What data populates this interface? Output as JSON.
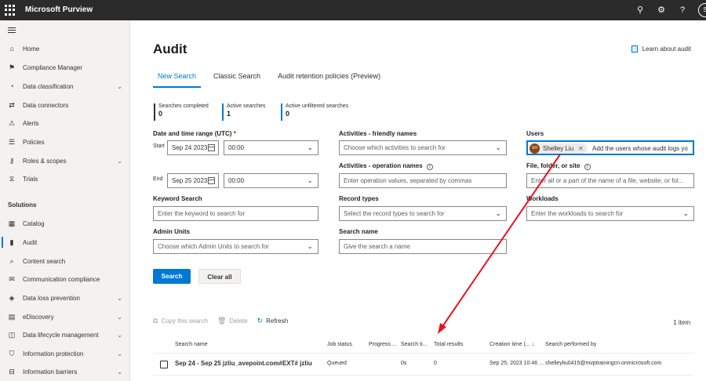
{
  "app": {
    "title": "Microsoft Purview",
    "avatar_initial": "S"
  },
  "topbar_icons": [
    {
      "name": "share-icon",
      "glyph": "⚲"
    },
    {
      "name": "gear-icon",
      "glyph": "⚙"
    },
    {
      "name": "help-icon",
      "glyph": "?"
    }
  ],
  "sidebar": {
    "items": [
      {
        "label": "Home",
        "icon": "⌂"
      },
      {
        "label": "Compliance Manager",
        "icon": "⚑"
      },
      {
        "label": "Data classification",
        "icon": "◔",
        "chevron": true
      },
      {
        "label": "Data connectors",
        "icon": "⇄"
      },
      {
        "label": "Alerts",
        "icon": "⚠"
      },
      {
        "label": "Policies",
        "icon": "☰"
      },
      {
        "label": "Roles & scopes",
        "icon": "⚷",
        "chevron": true
      },
      {
        "label": "Trials",
        "icon": "⧖"
      }
    ],
    "solutions_title": "Solutions",
    "solutions": [
      {
        "label": "Catalog",
        "icon": "▦"
      },
      {
        "label": "Audit",
        "icon": "▮",
        "active": true
      },
      {
        "label": "Content search",
        "icon": "⌕"
      },
      {
        "label": "Communication compliance",
        "icon": "✉"
      },
      {
        "label": "Data loss prevention",
        "icon": "◈",
        "chevron": true
      },
      {
        "label": "eDiscovery",
        "icon": "▤",
        "chevron": true
      },
      {
        "label": "Data lifecycle management",
        "icon": "◫",
        "chevron": true
      },
      {
        "label": "Information protection",
        "icon": "⛉",
        "chevron": true
      },
      {
        "label": "Information barriers",
        "icon": "⊟",
        "chevron": true
      }
    ]
  },
  "page": {
    "title": "Audit",
    "learn_link": "Learn about audit"
  },
  "tabs": [
    {
      "label": "New Search",
      "active": true
    },
    {
      "label": "Classic Search"
    },
    {
      "label": "Audit retention policies (Preview)"
    }
  ],
  "stats": [
    {
      "label": "Searches completed",
      "value": "0",
      "color": "#323130"
    },
    {
      "label": "Active searches",
      "value": "1",
      "color": "#0078d4"
    },
    {
      "label": "Active unfiltered searches",
      "value": "0",
      "color": "#0078d4"
    }
  ],
  "form": {
    "date_range_label": "Date and time range (UTC)",
    "required_mark": "*",
    "start_label": "Start",
    "start_date": "Sep 24 2023",
    "start_time": "00:00",
    "end_label": "End",
    "end_date": "Sep 25 2023",
    "end_time": "00:00",
    "activities_friendly_label": "Activities - friendly names",
    "activities_friendly_placeholder": "Choose which activities to search for",
    "activities_operation_label": "Activities - operation names",
    "activities_operation_placeholder": "Enter operation values, separated by commas",
    "users_label": "Users",
    "users_chip_initials": "SH",
    "users_chip_name": "Shelley Liu",
    "users_placeholder": "Add the users whose audit logs yo",
    "file_label": "File, folder, or site",
    "file_placeholder": "Enter all or a part of the name of a file, website, or fol...",
    "keyword_label": "Keyword Search",
    "keyword_placeholder": "Enter the keyword to search for",
    "record_types_label": "Record types",
    "record_types_placeholder": "Select the record types to search for",
    "workloads_label": "Workloads",
    "workloads_placeholder": "Enter the workloads to search for",
    "admin_units_label": "Admin Units",
    "admin_units_placeholder": "Choose which Admin Units to search for",
    "search_name_label": "Search name",
    "search_name_placeholder": "Give the search a name",
    "search_button": "Search",
    "clear_button": "Clear all"
  },
  "results": {
    "commands": {
      "copy": "Copy this search",
      "delete": "Delete",
      "refresh": "Refresh"
    },
    "count": "1 item",
    "columns": {
      "search_name": "Search name",
      "job_status": "Job status",
      "progress": "Progress ...",
      "search_time": "Search ti...",
      "total_results": "Total results",
      "creation_time": "Creation time (... ↓",
      "performed_by": "Search performed by"
    },
    "rows": [
      {
        "search_name": "Sep 24 - Sep 25 jzliu_avepoint.com#EXT# jzliu",
        "job_status": "Queued",
        "search_time": "0s",
        "total_results": "0",
        "creation_time": "Sep 25, 2023 10:46 ...",
        "performed_by": "shelleyliu0415@mvptrainingcn.onmicrosoft.com"
      }
    ]
  },
  "annotation": {
    "arrow_color": "#e81123"
  }
}
